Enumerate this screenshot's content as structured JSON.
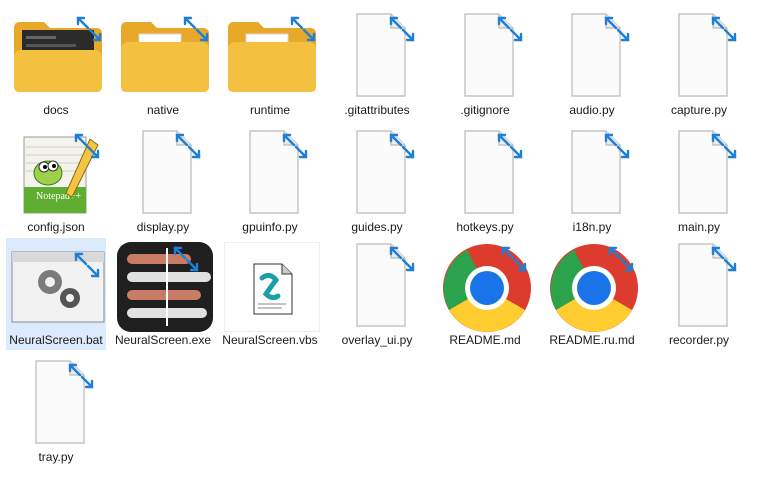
{
  "files": [
    {
      "name": "docs",
      "type": "folder-dark"
    },
    {
      "name": "native",
      "type": "folder"
    },
    {
      "name": "runtime",
      "type": "folder"
    },
    {
      "name": ".gitattributes",
      "type": "blank"
    },
    {
      "name": ".gitignore",
      "type": "blank"
    },
    {
      "name": "audio.py",
      "type": "blank"
    },
    {
      "name": "capture.py",
      "type": "blank"
    },
    {
      "name": "config.json",
      "type": "notepad"
    },
    {
      "name": "display.py",
      "type": "blank"
    },
    {
      "name": "gpuinfo.py",
      "type": "blank"
    },
    {
      "name": "guides.py",
      "type": "blank"
    },
    {
      "name": "hotkeys.py",
      "type": "blank"
    },
    {
      "name": "i18n.py",
      "type": "blank"
    },
    {
      "name": "main.py",
      "type": "blank"
    },
    {
      "name": "NeuralScreen.bat",
      "type": "bat",
      "selected": true
    },
    {
      "name": "NeuralScreen.exe",
      "type": "exe"
    },
    {
      "name": "NeuralScreen.vbs",
      "type": "vbs"
    },
    {
      "name": "overlay_ui.py",
      "type": "blank"
    },
    {
      "name": "README.md",
      "type": "chrome"
    },
    {
      "name": "README.ru.md",
      "type": "chrome"
    },
    {
      "name": "recorder.py",
      "type": "blank"
    },
    {
      "name": "tray.py",
      "type": "blank"
    }
  ],
  "colors": {
    "shortcut_arrow": "#1e7fd6",
    "folder": "#f3c040",
    "selection": "#dbeafc"
  }
}
